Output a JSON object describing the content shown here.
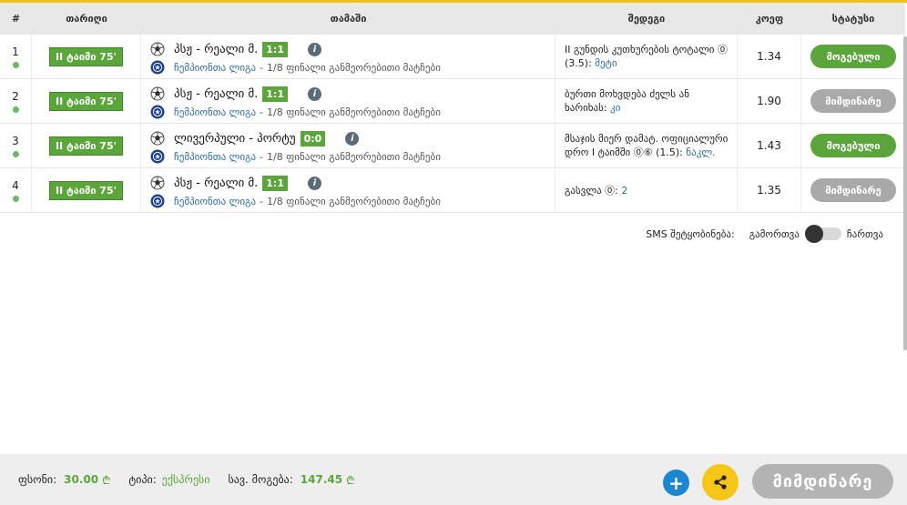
{
  "header": {
    "num": "#",
    "date": "თარიღი",
    "game": "თამაში",
    "event": "შედეგი",
    "odds": "კოეფ",
    "status": "სტატუსი"
  },
  "rows": [
    {
      "num": "1",
      "time": "II ტაიმი 75'",
      "teams": "პსჟ - რეალი მ.",
      "score": "1:1",
      "league": "ჩემპიონთა ლიგა",
      "stage": "1/8 ფინალი განმეორებითი მატჩები",
      "event_text": "II გუნდის კუთხურების ტოტალი ⓪ (3.5):",
      "event_pick": "მეტი",
      "odds": "1.34",
      "status": "მოგებული"
    },
    {
      "num": "2",
      "time": "II ტაიმი 75'",
      "teams": "პსჟ - რეალი მ.",
      "score": "1:1",
      "league": "ჩემპიონთა ლიგა",
      "stage": "1/8 ფინალი განმეორებითი მატჩები",
      "event_text": "ბურთი მოხვდება ძელს ან ხარიხას:",
      "event_pick": "კი",
      "odds": "1.90",
      "status": "მიმდინარე"
    },
    {
      "num": "3",
      "time": "II ტაიმი 75'",
      "teams": "ლივერპული - პორტუ",
      "score": "0:0",
      "league": "ჩემპიონთა ლიგა",
      "stage": "1/8 ფინალი განმეორებითი მატჩები",
      "event_text": "მსაჯის მიერ დამატ. ოფიციალური დრო I ტაიმში ⓪⑥ (1.5):",
      "event_pick": "ნაკლ.",
      "odds": "1.43",
      "status": "მოგებული"
    },
    {
      "num": "4",
      "time": "II ტაიმი 75'",
      "teams": "პსჟ - რეალი მ.",
      "score": "1:1",
      "league": "ჩემპიონთა ლიგა",
      "stage": "1/8 ფინალი განმეორებითი მატჩები",
      "event_text": "გასვლა ⓪:",
      "event_pick": "2",
      "odds": "1.35",
      "status": "მიმდინარე"
    }
  ],
  "sms": {
    "label": "SMS შეტყობინება:",
    "off": "გამორთვა",
    "on": "ჩართვა"
  },
  "footer": {
    "stake_label": "ფსონი:",
    "stake_value": "30.00",
    "type_label": "ტიპი:",
    "type_value": "ექსპრესი",
    "win_label": "სავ. მოგება:",
    "win_value": "147.45",
    "currency": "₾",
    "status_button": "მიმდინარე"
  },
  "colors": {
    "accent_green": "#5aa63a",
    "pending_gray": "#a9a9a9",
    "link_blue": "#2a6aa8",
    "share_yellow": "#f5c518",
    "add_blue": "#1d86d0"
  }
}
